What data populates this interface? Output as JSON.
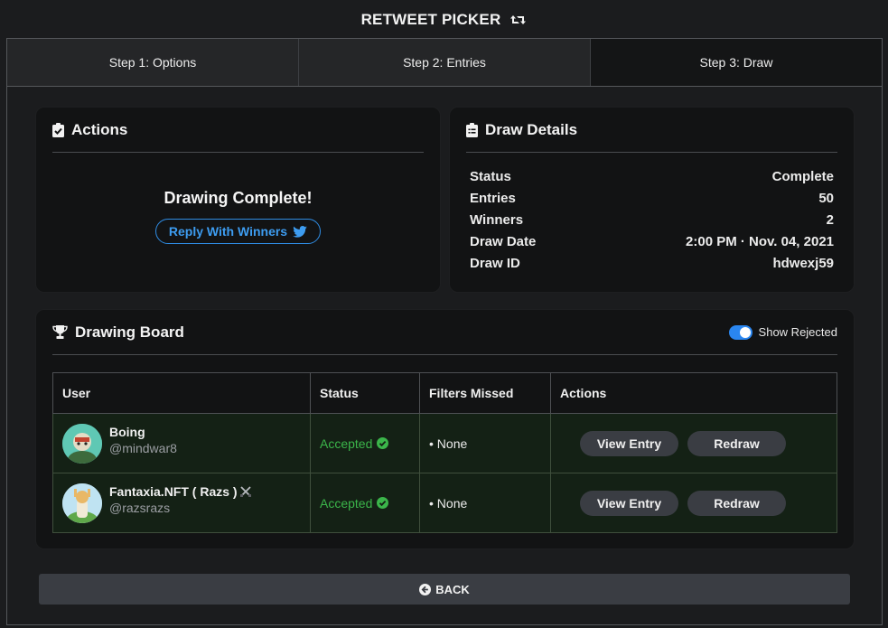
{
  "app": {
    "title": "RETWEET PICKER"
  },
  "tabs": [
    {
      "label": "Step 1: Options"
    },
    {
      "label": "Step 2: Entries"
    },
    {
      "label": "Step 3: Draw",
      "active": true
    }
  ],
  "actions_card": {
    "title": "Actions",
    "message": "Drawing Complete!",
    "reply_label": "Reply With Winners"
  },
  "details_card": {
    "title": "Draw Details",
    "rows": [
      {
        "label": "Status",
        "value": "Complete"
      },
      {
        "label": "Entries",
        "value": "50"
      },
      {
        "label": "Winners",
        "value": "2"
      },
      {
        "label": "Draw Date",
        "value": "2:00 PM · Nov. 04, 2021"
      },
      {
        "label": "Draw ID",
        "value": "hdwexj59"
      }
    ]
  },
  "board": {
    "title": "Drawing Board",
    "toggle_label": "Show Rejected",
    "toggle_on": true,
    "columns": [
      "User",
      "Status",
      "Filters Missed",
      "Actions"
    ],
    "rows": [
      {
        "name": "Boing",
        "handle": "@mindwar8",
        "status": "Accepted",
        "filters": "• None",
        "view_label": "View Entry",
        "redraw_label": "Redraw"
      },
      {
        "name": "Fantaxia.NFT ( Razs )",
        "handle": "@razsrazs",
        "status": "Accepted",
        "filters": "• None",
        "view_label": "View Entry",
        "redraw_label": "Redraw"
      }
    ]
  },
  "back_label": "BACK",
  "colors": {
    "accent_blue": "#2f8ce3",
    "accepted_green": "#3bb54a",
    "row_bg": "#142115"
  }
}
